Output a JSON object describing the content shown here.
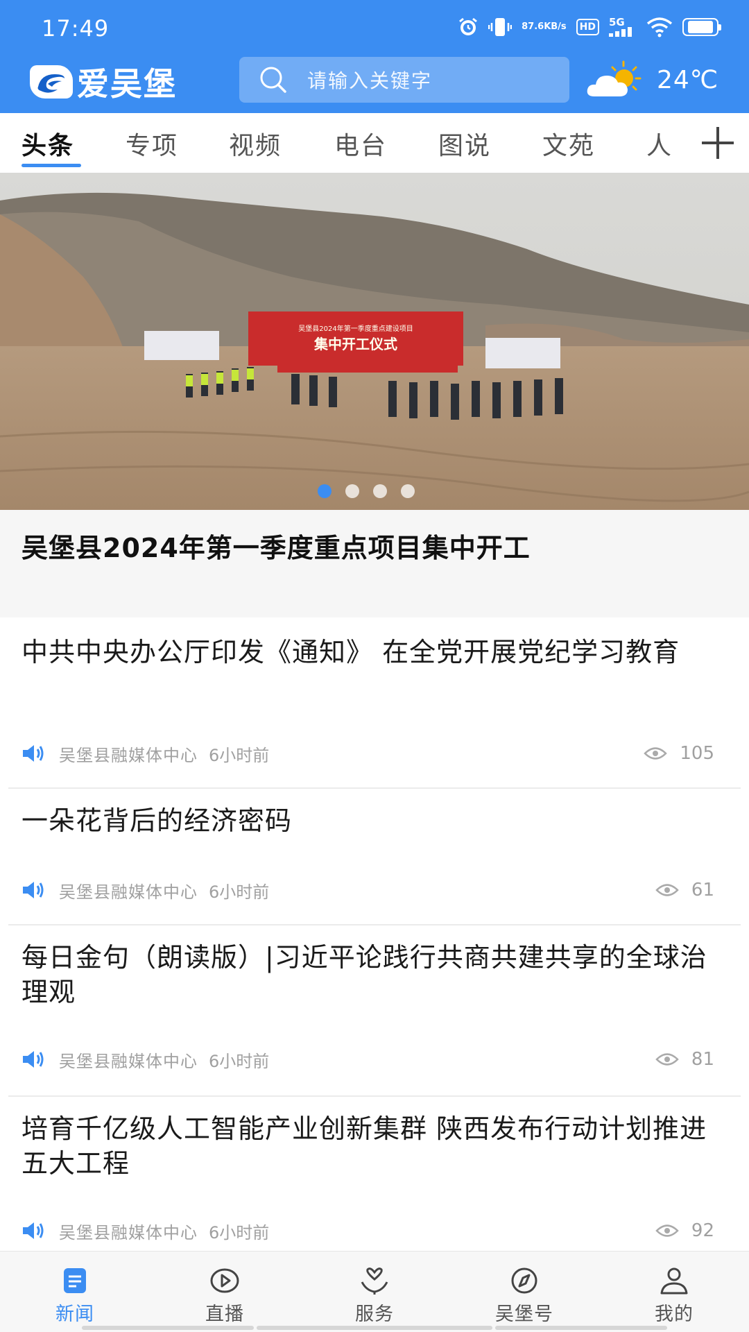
{
  "status_bar": {
    "time": "17:49",
    "net_speed_value": "87.6",
    "net_speed_unit": "KB/s",
    "hd_label": "HD",
    "network_label": "5G",
    "battery_level": 0.8,
    "icons": [
      "alarm-icon",
      "vibrate-icon",
      "hd-icon",
      "signal-5g-icon",
      "wifi-icon",
      "battery-icon"
    ]
  },
  "app_bar": {
    "logo_text": "爱吴堡",
    "search_placeholder": "请输入关键字",
    "weather_icon": "partly-cloudy-icon",
    "temperature": "24℃"
  },
  "tabs": {
    "items": [
      "头条",
      "专项",
      "视频",
      "电台",
      "图说",
      "文苑",
      "人文"
    ],
    "active_index": 0,
    "add_icon": "plus-icon"
  },
  "banner": {
    "sign_line1": "吴堡县2024年第一季度重点建设项目",
    "sign_line2": "集中开工仪式",
    "slide_count": 4,
    "active_slide": 0,
    "title": "吴堡县2024年第一季度重点项目集中开工"
  },
  "colors": {
    "brand": "#3b8df2",
    "meta_text": "#a0a0a0",
    "caption_bg": "#f6f6f6"
  },
  "news": [
    {
      "title": "中共中央办公厅印发《通知》 在全党开展党纪学习教育",
      "source": "吴堡县融媒体中心",
      "time": "6小时前",
      "views": "105"
    },
    {
      "title": "一朵花背后的经济密码",
      "source": "吴堡县融媒体中心",
      "time": "6小时前",
      "views": "61"
    },
    {
      "title": "每日金句（朗读版）|习近平论践行共商共建共享的全球治理观",
      "source": "吴堡县融媒体中心",
      "time": "6小时前",
      "views": "81"
    },
    {
      "title": "培育千亿级人工智能产业创新集群 陕西发布行动计划推进五大工程",
      "source": "吴堡县融媒体中心",
      "time": "6小时前",
      "views": "92"
    }
  ],
  "bottom_nav": {
    "items": [
      {
        "label": "新闻",
        "icon": "news-icon"
      },
      {
        "label": "直播",
        "icon": "live-play-icon"
      },
      {
        "label": "服务",
        "icon": "service-icon"
      },
      {
        "label": "吴堡号",
        "icon": "compass-icon"
      },
      {
        "label": "我的",
        "icon": "user-icon"
      }
    ],
    "active_index": 0
  }
}
